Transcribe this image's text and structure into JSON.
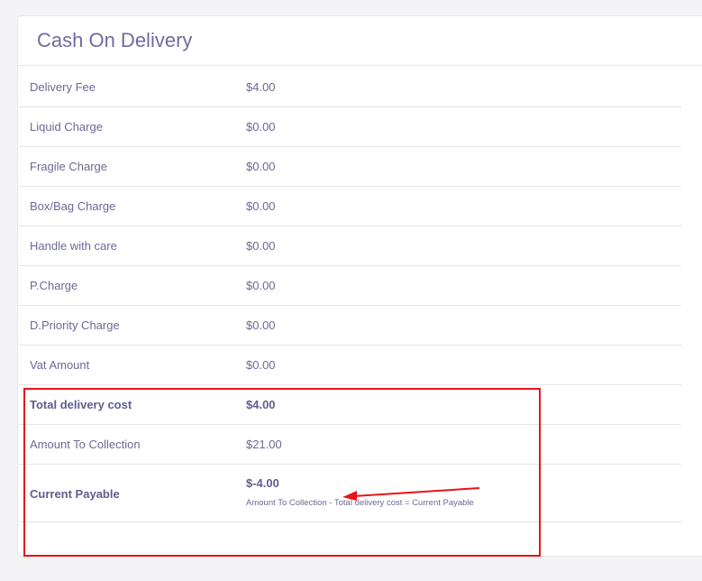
{
  "panel": {
    "title": "Cash On Delivery"
  },
  "rows": [
    {
      "label": "Delivery Fee",
      "value": "$4.00"
    },
    {
      "label": "Liquid Charge",
      "value": "$0.00"
    },
    {
      "label": "Fragile Charge",
      "value": "$0.00"
    },
    {
      "label": "Box/Bag Charge",
      "value": "$0.00"
    },
    {
      "label": "Handle with care",
      "value": "$0.00"
    },
    {
      "label": "P.Charge",
      "value": "$0.00"
    },
    {
      "label": "D.Priority Charge",
      "value": "$0.00"
    },
    {
      "label": "Vat Amount",
      "value": "$0.00"
    },
    {
      "label": "Total delivery cost",
      "value": "$4.00"
    },
    {
      "label": "Amount To Collection",
      "value": "$21.00"
    }
  ],
  "payable": {
    "label": "Current Payable",
    "value": "$-4.00",
    "note": "Amount To Collection - Total delivery cost = Current Payable"
  },
  "annotation": {
    "color": "#e8141a"
  }
}
